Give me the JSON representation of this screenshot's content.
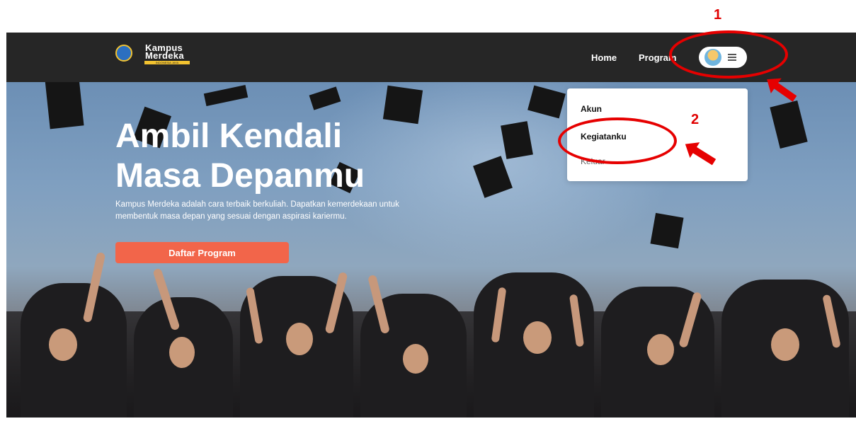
{
  "annotations": {
    "step_1": "1",
    "step_2": "2"
  },
  "navbar": {
    "logo": {
      "line1": "Kampus",
      "line2": "Merdeka",
      "tagline": "INDONESIA JAYA"
    },
    "links": {
      "home": "Home",
      "program": "Program"
    },
    "account_toggle": {
      "avatar_icon": "user-avatar",
      "menu_icon": "hamburger-icon"
    },
    "background_color": "#262626"
  },
  "hero": {
    "title_line1": "Ambil Kendali",
    "title_line2": "Masa Depanmu",
    "description": "Kampus Merdeka adalah cara terbaik berkuliah. Dapatkan kemerdekaan untuk membentuk masa depan yang sesuai dengan aspirasi kariermu.",
    "cta_label": "Daftar Program",
    "cta_color": "#f2654a"
  },
  "dropdown": {
    "items": [
      {
        "label": "Akun"
      },
      {
        "label": "Kegiatanku"
      },
      {
        "label": "Keluar"
      }
    ]
  },
  "colors": {
    "annotation_red": "#e60000"
  }
}
